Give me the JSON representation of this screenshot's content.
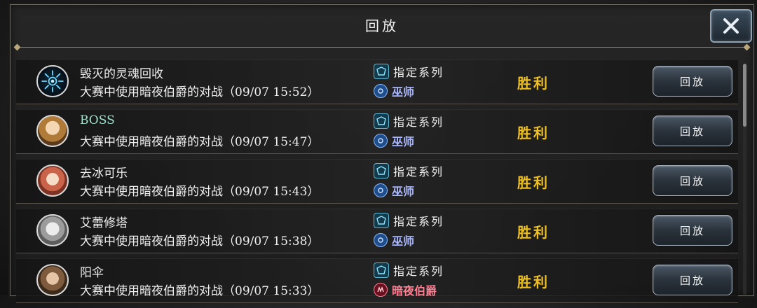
{
  "dialog": {
    "title": "回放"
  },
  "rows": [
    {
      "name": "毁灭的灵魂回收",
      "description": "大赛中使用暗夜伯爵的对战（09/07 15:52）",
      "mode": "指定系列",
      "class": "巫师",
      "class_type": "mage",
      "result": "胜利",
      "button": "回放"
    },
    {
      "name": "BOSS",
      "description": "大赛中使用暗夜伯爵的对战（09/07 15:47）",
      "mode": "指定系列",
      "class": "巫师",
      "class_type": "mage",
      "result": "胜利",
      "button": "回放"
    },
    {
      "name": "去冰可乐",
      "description": "大赛中使用暗夜伯爵的对战（09/07 15:43）",
      "mode": "指定系列",
      "class": "巫师",
      "class_type": "mage",
      "result": "胜利",
      "button": "回放"
    },
    {
      "name": "艾蕾修塔",
      "description": "大赛中使用暗夜伯爵的对战（09/07 15:38）",
      "mode": "指定系列",
      "class": "巫师",
      "class_type": "mage",
      "result": "胜利",
      "button": "回放"
    },
    {
      "name": "阳伞",
      "description": "大赛中使用暗夜伯爵的对战（09/07 15:33）",
      "mode": "指定系列",
      "class": "暗夜伯爵",
      "class_type": "night",
      "result": "胜利",
      "button": "回放"
    }
  ],
  "colors": {
    "result": "#f0c020",
    "mage_text": "#a9b7ff",
    "night_text": "#ff7f93",
    "name_highlight": "#9fe3cf"
  },
  "icons": {
    "close": "close-icon",
    "mode": "format-icon",
    "mage": "mage-class-icon",
    "night": "nightlord-class-icon"
  }
}
